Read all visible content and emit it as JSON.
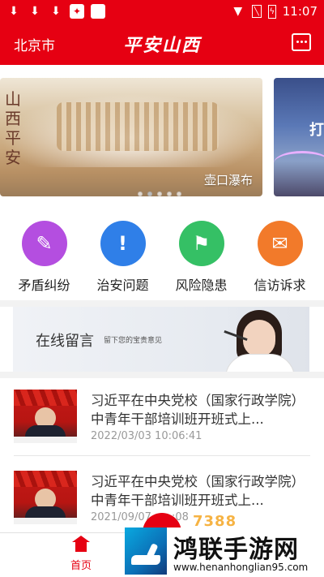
{
  "status_bar": {
    "time": "11:07",
    "icons": [
      "download-icon",
      "download-icon",
      "download-icon",
      "app-notification-icon",
      "square-icon",
      "wifi-icon",
      "no-sim-icon",
      "battery-charging-icon"
    ]
  },
  "header": {
    "city": "北京市",
    "title": "平安山西",
    "message_icon": "message-icon",
    "color": "#e60012"
  },
  "banner": {
    "main_caption": "壶口瀑布",
    "main_seal_text": "山西平安",
    "next_slide_text": "打",
    "dot_count": 5,
    "active_dot": 1
  },
  "quick_actions": [
    {
      "label": "矛盾纠纷",
      "icon": "dispute-icon",
      "color": "#b44ee0"
    },
    {
      "label": "治安问题",
      "icon": "alert-shield-icon",
      "color": "#2f7fe8"
    },
    {
      "label": "风险隐患",
      "icon": "risk-icon",
      "color": "#35c065"
    },
    {
      "label": "信访诉求",
      "icon": "petition-icon",
      "color": "#f27a2a"
    }
  ],
  "ad_banner": {
    "title": "在线留言",
    "subtitle": "留下您的宝贵意见"
  },
  "news": [
    {
      "title": "习近平在中央党校（国家行政学院）中青年干部培训班开班式上...",
      "time": "2022/03/03 10:06:41"
    },
    {
      "title": "习近平在中央党校（国家行政学院）中青年干部培训班开班式上...",
      "time": "2021/09/07 ..:..:08"
    }
  ],
  "tab_bar": {
    "home_label": "首页",
    "home_icon": "home-icon"
  },
  "watermark": {
    "text": "鸿联手游网",
    "url": "www.henanhonglian95.com",
    "overlay_text": "7388"
  }
}
